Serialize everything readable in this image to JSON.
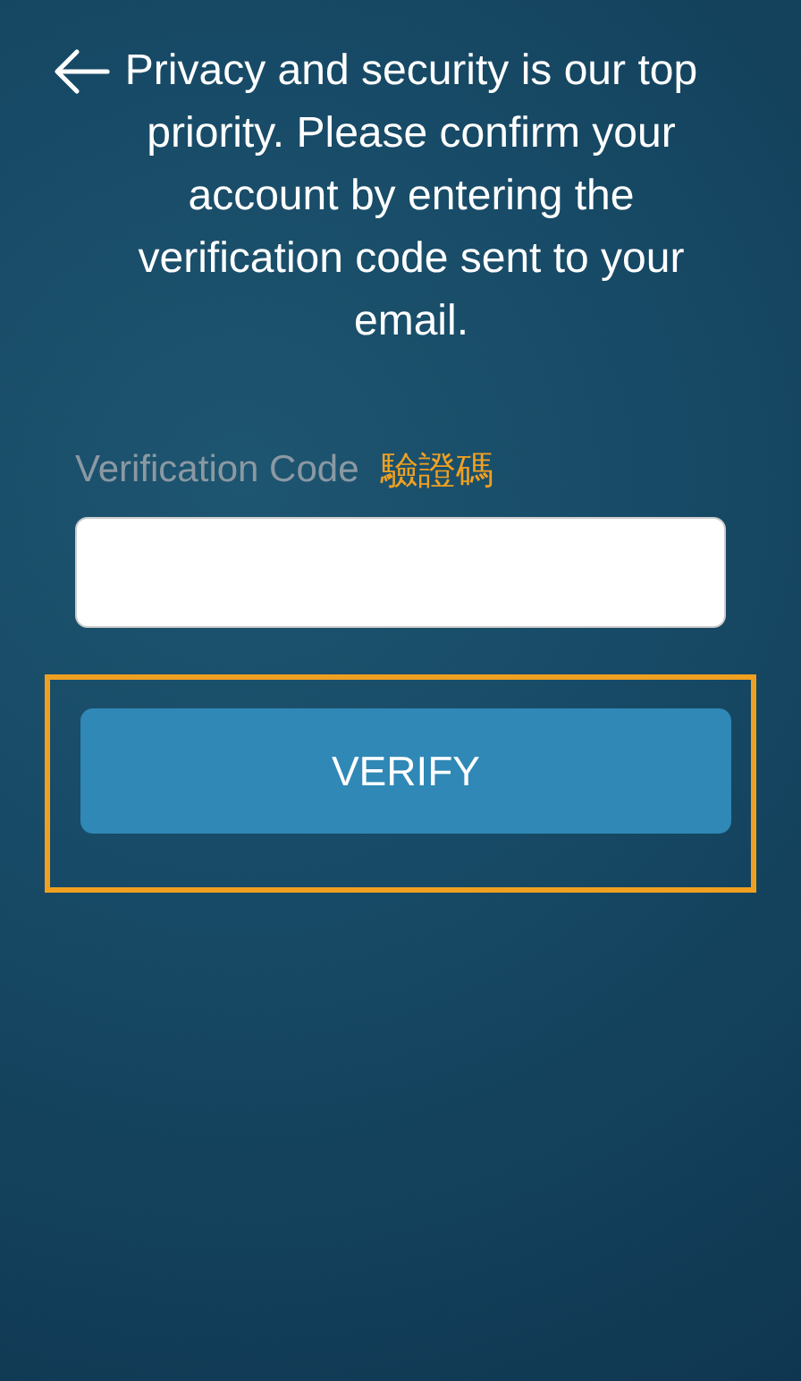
{
  "header": {
    "back_icon": true,
    "message": "Privacy and security is our top priority. Please confirm your account by entering the verification code sent to your email."
  },
  "form": {
    "label": "Verification Code",
    "annotation": "驗證碼",
    "button": "VERIFY",
    "button_highlighted": true
  }
}
